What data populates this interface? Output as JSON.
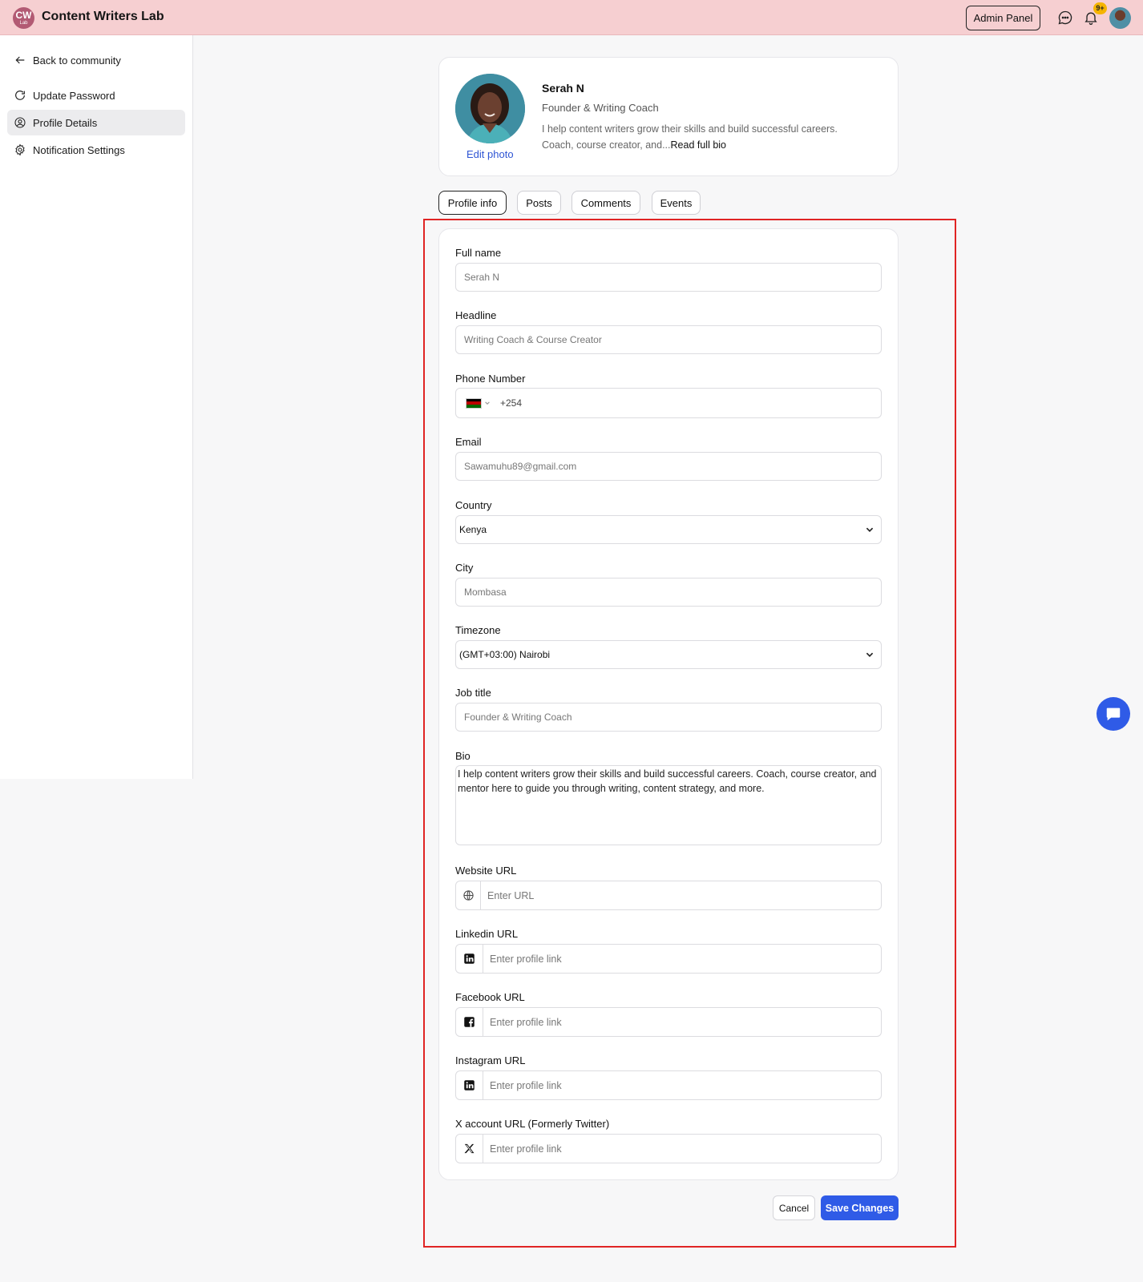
{
  "header": {
    "logo_text": "CW",
    "logo_sub": "Lab",
    "brand": "Content Writers Lab",
    "admin_label": "Admin Panel",
    "notification_badge": "9+"
  },
  "sidebar": {
    "back": "Back to community",
    "items": [
      {
        "label": "Update Password",
        "icon": "refresh-icon"
      },
      {
        "label": "Profile Details",
        "icon": "user-circle-icon",
        "active": true
      },
      {
        "label": "Notification Settings",
        "icon": "gear-icon"
      }
    ]
  },
  "profile": {
    "name": "Serah N",
    "headline": "Founder & Writing Coach",
    "bio_preview": "I help content writers grow their skills and build successful careers. Coach, course creator, and...",
    "read_more": "Read full bio",
    "edit_photo": "Edit photo"
  },
  "tabs": [
    "Profile info",
    "Posts",
    "Comments",
    "Events"
  ],
  "form": {
    "full_name": {
      "label": "Full name",
      "value": "Serah N"
    },
    "headline": {
      "label": "Headline",
      "value": "Writing Coach & Course Creator"
    },
    "phone": {
      "label": "Phone Number",
      "value": "+254"
    },
    "email": {
      "label": "Email",
      "value": "Sawamuhu89@gmail.com"
    },
    "country": {
      "label": "Country",
      "value": "Kenya"
    },
    "city": {
      "label": "City",
      "value": "Mombasa"
    },
    "timezone": {
      "label": "Timezone",
      "value": "(GMT+03:00) Nairobi"
    },
    "job_title": {
      "label": "Job title",
      "value": "Founder & Writing Coach"
    },
    "bio": {
      "label": "Bio",
      "value": "I help content writers grow their skills and build successful careers. Coach, course creator, and mentor here to guide you through writing, content strategy, and more."
    },
    "website": {
      "label": "Website URL",
      "placeholder": "Enter URL"
    },
    "linkedin": {
      "label": "Linkedin URL",
      "placeholder": "Enter profile link"
    },
    "facebook": {
      "label": "Facebook URL",
      "placeholder": "Enter profile link"
    },
    "instagram": {
      "label": "Instagram URL",
      "placeholder": "Enter profile link"
    },
    "x_account": {
      "label": "X account URL (Formerly Twitter)",
      "placeholder": "Enter profile link"
    }
  },
  "actions": {
    "cancel": "Cancel",
    "save": "Save Changes"
  },
  "colors": {
    "header_bg": "#f6cfd1",
    "accent": "#2f5be7",
    "highlight": "#e02424"
  }
}
